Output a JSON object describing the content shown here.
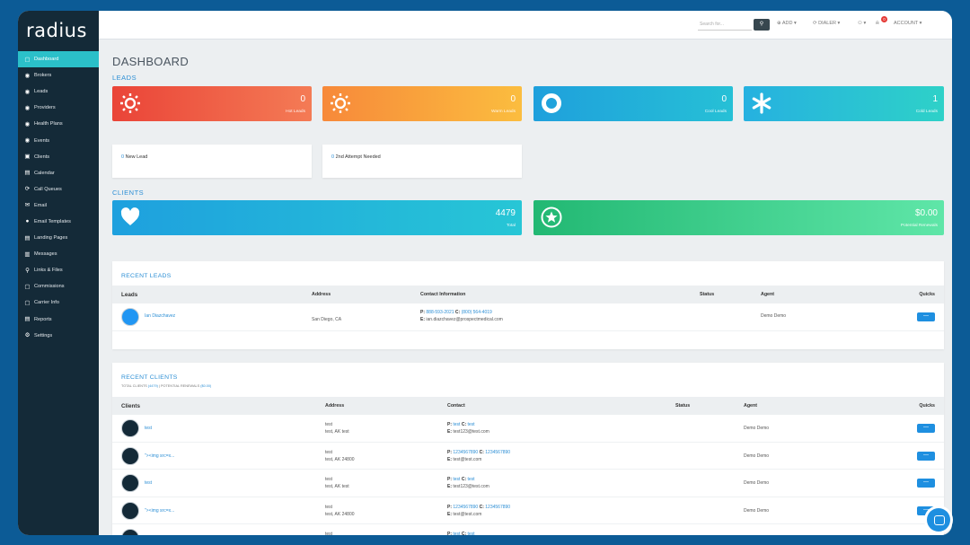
{
  "app": {
    "logo": "radius"
  },
  "sidebar": {
    "items": [
      {
        "label": "Dashboard",
        "icon": "dashboard-icon",
        "glyph": "▢",
        "active": true
      },
      {
        "label": "Brokers",
        "icon": "brokers-icon",
        "glyph": "◉"
      },
      {
        "label": "Leads",
        "icon": "leads-icon",
        "glyph": "◉"
      },
      {
        "label": "Providers",
        "icon": "providers-icon",
        "glyph": "◉"
      },
      {
        "label": "Health Plans",
        "icon": "health-plans-icon",
        "glyph": "◉"
      },
      {
        "label": "Events",
        "icon": "events-icon",
        "glyph": "◉"
      },
      {
        "label": "Clients",
        "icon": "clients-icon",
        "glyph": "▣"
      },
      {
        "label": "Calendar",
        "icon": "calendar-icon",
        "glyph": "▤"
      },
      {
        "label": "Call Queues",
        "icon": "call-queues-icon",
        "glyph": "⟳"
      },
      {
        "label": "Email",
        "icon": "email-icon",
        "glyph": "✉"
      },
      {
        "label": "Email Templates",
        "icon": "email-templates-icon",
        "glyph": "●"
      },
      {
        "label": "Landing Pages",
        "icon": "landing-pages-icon",
        "glyph": "▤"
      },
      {
        "label": "Messages",
        "icon": "messages-icon",
        "glyph": "▥"
      },
      {
        "label": "Links & Files",
        "icon": "links-files-icon",
        "glyph": "⚲"
      },
      {
        "label": "Commissions",
        "icon": "commissions-icon",
        "glyph": "▢"
      },
      {
        "label": "Carrier Info",
        "icon": "carrier-info-icon",
        "glyph": "▢"
      },
      {
        "label": "Reports",
        "icon": "reports-icon",
        "glyph": "▤"
      },
      {
        "label": "Settings",
        "icon": "settings-icon",
        "glyph": "⚙"
      }
    ]
  },
  "topbar": {
    "search_placeholder": "Search for...",
    "search_icon": "🔍",
    "add_label": "⊕ ADD ▾",
    "dialer_label": "⟳ DIALER ▾",
    "user_label": "⚇ ▾",
    "notifications_count": "0",
    "account_label": "ACCOUNT ▾"
  },
  "dashboard": {
    "title": "DASHBOARD",
    "leads_section": "LEADS",
    "clients_section": "CLIENTS",
    "stats": {
      "hot": {
        "value": "0",
        "label": "Hot Leads"
      },
      "warm": {
        "value": "0",
        "label": "Warm Leads"
      },
      "cool": {
        "value": "0",
        "label": "Cool Leads"
      },
      "cold": {
        "value": "1",
        "label": "Cold Leads"
      },
      "total": {
        "value": "4479",
        "label": "Total"
      },
      "potential": {
        "value": "$0.00",
        "label": "Potential Renewals"
      }
    },
    "mini": {
      "new_lead": {
        "count": "0",
        "label": "New Lead"
      },
      "second_attempt": {
        "count": "0",
        "label": "2nd Attempt Needed"
      }
    }
  },
  "recent_leads": {
    "title": "RECENT LEADS",
    "columns": [
      "Leads",
      "Address",
      "Contact Information",
      "Status",
      "Agent",
      "Quicks"
    ],
    "rows": [
      {
        "name": "Ian Diazchavez",
        "address": "San Diego, CA",
        "phone_p": "888-593-2021",
        "phone_c": "(800) 564-4019",
        "email": "ian.diazchavez@prospectmedical.com",
        "status": "",
        "agent": "Demo Demo",
        "quick": "—"
      }
    ]
  },
  "recent_clients": {
    "title": "RECENT CLIENTS",
    "sub_total_label": "TOTAL CLIENTS",
    "sub_total_value": "(4479)",
    "sub_sep": " | ",
    "sub_pot_label": "POTENTIAL RENEWALS",
    "sub_pot_value": "($0.00)",
    "columns": [
      "Clients",
      "Address",
      "Contact",
      "Status",
      "Agent",
      "Quicks"
    ],
    "rows": [
      {
        "name": "test",
        "addr1": "test",
        "addr2": "test, AK test",
        "p": "test",
        "c": "test",
        "email": "test123@test.com",
        "agent": "Demo Demo",
        "quick": "—"
      },
      {
        "name": "\"><img src=x...",
        "addr1": "test",
        "addr2": "test, AK 24800",
        "p": "1234567890",
        "c": "1234567890",
        "email": "test@test.com",
        "agent": "Demo Demo",
        "quick": "—"
      },
      {
        "name": "test",
        "addr1": "test",
        "addr2": "test, AK test",
        "p": "test",
        "c": "test",
        "email": "test123@test.com",
        "agent": "Demo Demo",
        "quick": "—"
      },
      {
        "name": "\"><img src=x...",
        "addr1": "test",
        "addr2": "test, AK 24800",
        "p": "1234567890",
        "c": "1234567890",
        "email": "test@test.com",
        "agent": "Demo Demo",
        "quick": "—"
      },
      {
        "name": "",
        "addr1": "test",
        "addr2": "",
        "p": "test",
        "c": "test",
        "email": "",
        "agent": "",
        "quick": ""
      }
    ]
  },
  "labels": {
    "p": "P:",
    "c": "C:",
    "e": "E:"
  }
}
